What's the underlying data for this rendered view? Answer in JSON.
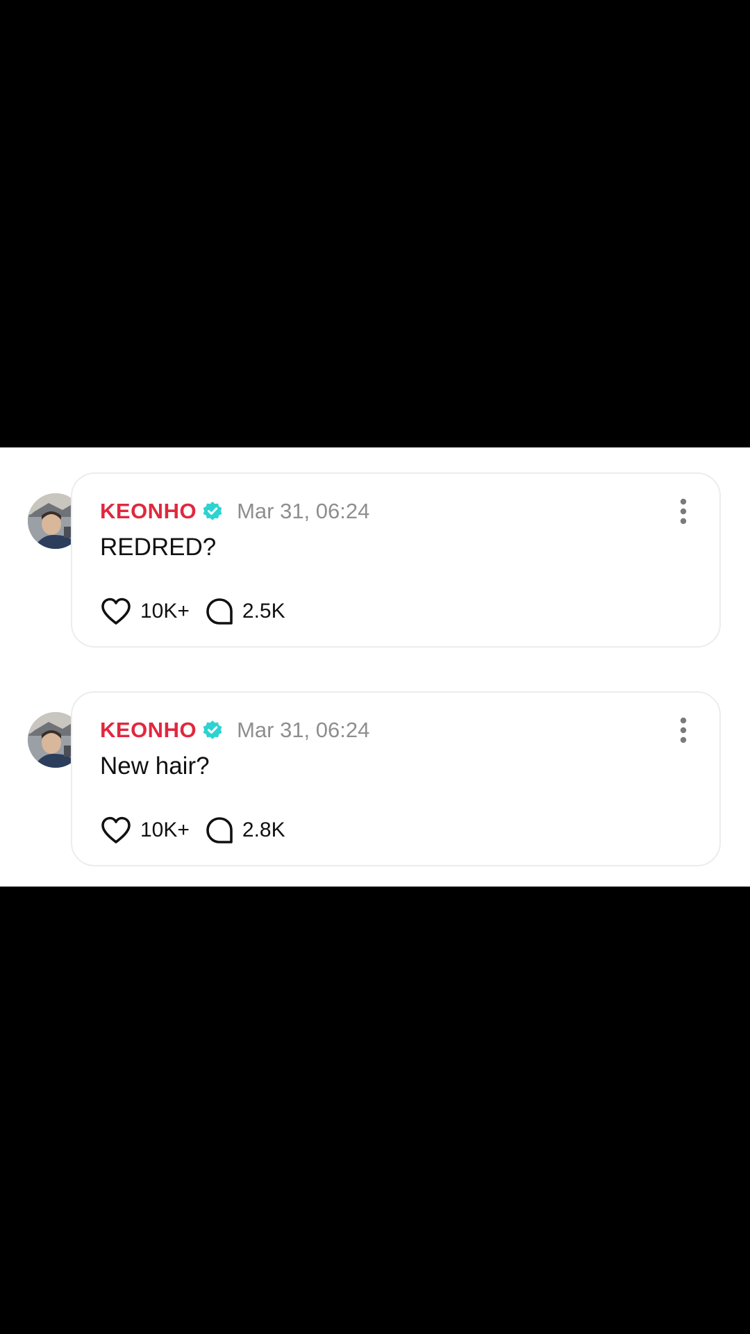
{
  "theme": {
    "author_color": "#e0283f",
    "verified_color": "#2cd3d0",
    "timestamp_color": "#8e8e8e"
  },
  "posts": [
    {
      "author": "KEONHO",
      "verified_icon": "verified-badge-icon",
      "timestamp": "Mar 31, 06:24",
      "text": "REDRED?",
      "likes": "10K+",
      "comments": "2.5K",
      "like_icon": "heart-icon",
      "comment_icon": "comment-bubble-icon",
      "more_icon": "more-vertical-icon"
    },
    {
      "author": "KEONHO",
      "verified_icon": "verified-badge-icon",
      "timestamp": "Mar 31, 06:24",
      "text": "New hair?",
      "likes": "10K+",
      "comments": "2.8K",
      "like_icon": "heart-icon",
      "comment_icon": "comment-bubble-icon",
      "more_icon": "more-vertical-icon"
    }
  ]
}
